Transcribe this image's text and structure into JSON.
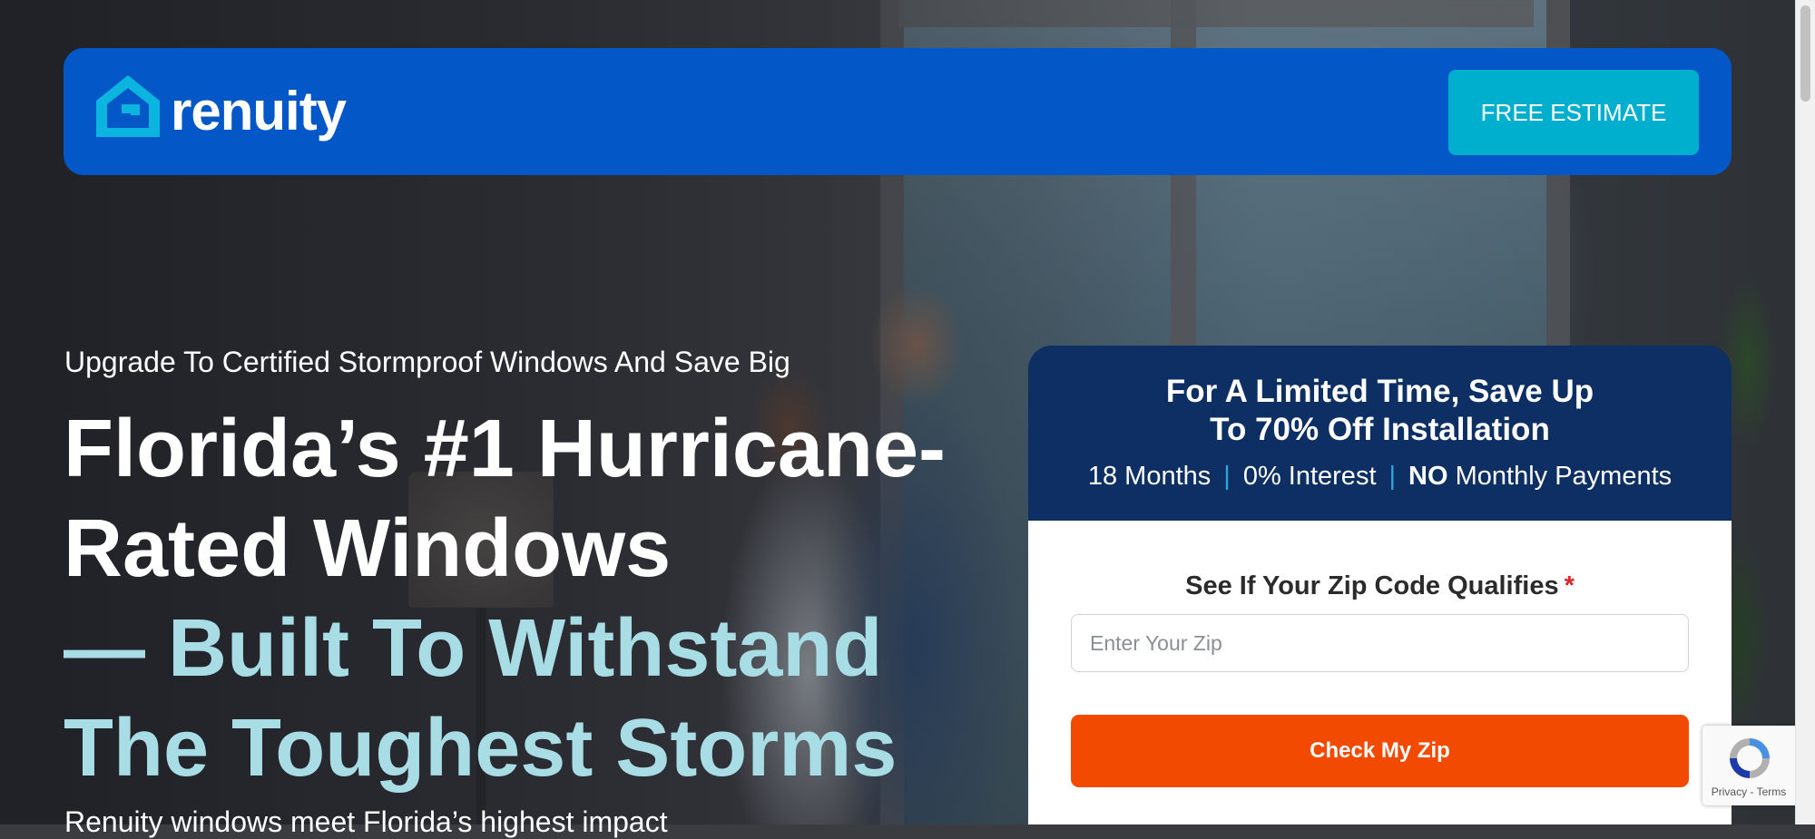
{
  "header": {
    "brand": "renuity",
    "cta_label": "FREE ESTIMATE"
  },
  "hero": {
    "eyebrow": "Upgrade To Certified Stormproof Windows And Save Big",
    "heading_line1": "Florida’s #1 Hurricane-",
    "heading_line2": "Rated Windows",
    "heading_accent_line1": "— Built To Withstand",
    "heading_accent_line2": "The Toughest Storms",
    "subtext": "Renuity windows meet Florida’s highest impact"
  },
  "offer": {
    "title_line1": "For A Limited Time, Save Up",
    "title_line2": "To 70% Off Installation",
    "term1": "18 Months",
    "term2": "0% Interest",
    "term3_bold": "NO",
    "term3_rest": "Monthly Payments",
    "zip_label": "See If Your Zip Code Qualifies",
    "required_mark": "*",
    "zip_placeholder": "Enter Your Zip",
    "submit_label": "Check My Zip"
  },
  "recaptcha": {
    "privacy": "Privacy",
    "separator": "-",
    "terms": "Terms"
  },
  "colors": {
    "header_bg": "#0457c6",
    "cta_bg": "#00aecd",
    "promo_bg": "#0d2f64",
    "accent_text": "#a9dde6",
    "submit_bg": "#f24a00",
    "required": "#e0262b"
  },
  "icons": {
    "logo": "house-icon",
    "recaptcha": "recaptcha-icon"
  }
}
